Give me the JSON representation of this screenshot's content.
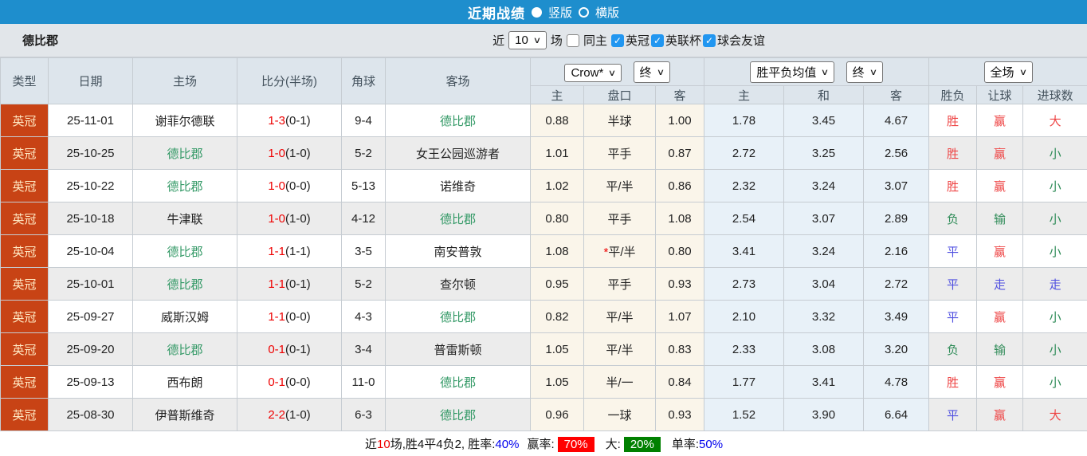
{
  "top_bar": {
    "title": "近期战绩",
    "radio_vertical": "竖版",
    "radio_horizontal": "横版"
  },
  "filter_bar": {
    "team": "德比郡",
    "near_label": "近",
    "matches_value": "10",
    "matches_label": "场",
    "same_home_label": "同主",
    "checkboxes": [
      {
        "label": "英冠",
        "checked": true
      },
      {
        "label": "英联杯",
        "checked": true
      },
      {
        "label": "球会友谊",
        "checked": true
      }
    ]
  },
  "table": {
    "left_headers": [
      "类型",
      "日期",
      "主场",
      "比分(半场)",
      "角球",
      "客场"
    ],
    "selects": {
      "odds_company": "Crow*",
      "odds_stage_1": "终",
      "avg_type": "胜平负均值",
      "odds_stage_2": "终",
      "scope": "全场"
    },
    "sub_headers": [
      "主",
      "盘口",
      "客",
      "主",
      "和",
      "客",
      "胜负",
      "让球",
      "进球数"
    ],
    "rows": [
      {
        "league": "英冠",
        "date": "25-11-01",
        "home": "谢菲尔德联",
        "home_self": false,
        "score": "1-3",
        "half_score": "(0-1)",
        "corners": "9-4",
        "away": "德比郡",
        "away_self": true,
        "ah_home": "0.88",
        "handicap_star": "",
        "handicap": "半球",
        "ah_away": "1.00",
        "avg_home": "1.78",
        "avg_draw": "3.45",
        "avg_away": "4.67",
        "result": "胜",
        "result_c": "red",
        "give": "赢",
        "give_c": "red",
        "goals": "大",
        "goals_c": "red"
      },
      {
        "league": "英冠",
        "date": "25-10-25",
        "home": "德比郡",
        "home_self": true,
        "score": "1-0",
        "half_score": "(1-0)",
        "corners": "5-2",
        "away": "女王公园巡游者",
        "away_self": false,
        "ah_home": "1.01",
        "handicap_star": "",
        "handicap": "平手",
        "ah_away": "0.87",
        "avg_home": "2.72",
        "avg_draw": "3.25",
        "avg_away": "2.56",
        "result": "胜",
        "result_c": "red",
        "give": "赢",
        "give_c": "red",
        "goals": "小",
        "goals_c": "green"
      },
      {
        "league": "英冠",
        "date": "25-10-22",
        "home": "德比郡",
        "home_self": true,
        "score": "1-0",
        "half_score": "(0-0)",
        "corners": "5-13",
        "away": "诺维奇",
        "away_self": false,
        "ah_home": "1.02",
        "handicap_star": "",
        "handicap": "平/半",
        "ah_away": "0.86",
        "avg_home": "2.32",
        "avg_draw": "3.24",
        "avg_away": "3.07",
        "result": "胜",
        "result_c": "red",
        "give": "赢",
        "give_c": "red",
        "goals": "小",
        "goals_c": "green"
      },
      {
        "league": "英冠",
        "date": "25-10-18",
        "home": "牛津联",
        "home_self": false,
        "score": "1-0",
        "half_score": "(1-0)",
        "corners": "4-12",
        "away": "德比郡",
        "away_self": true,
        "ah_home": "0.80",
        "handicap_star": "",
        "handicap": "平手",
        "ah_away": "1.08",
        "avg_home": "2.54",
        "avg_draw": "3.07",
        "avg_away": "2.89",
        "result": "负",
        "result_c": "green",
        "give": "输",
        "give_c": "green",
        "goals": "小",
        "goals_c": "green"
      },
      {
        "league": "英冠",
        "date": "25-10-04",
        "home": "德比郡",
        "home_self": true,
        "score": "1-1",
        "half_score": "(1-1)",
        "corners": "3-5",
        "away": "南安普敦",
        "away_self": false,
        "ah_home": "1.08",
        "handicap_star": "*",
        "handicap": "平/半",
        "ah_away": "0.80",
        "avg_home": "3.41",
        "avg_draw": "3.24",
        "avg_away": "2.16",
        "result": "平",
        "result_c": "blue",
        "give": "赢",
        "give_c": "red",
        "goals": "小",
        "goals_c": "green"
      },
      {
        "league": "英冠",
        "date": "25-10-01",
        "home": "德比郡",
        "home_self": true,
        "score": "1-1",
        "half_score": "(0-1)",
        "corners": "5-2",
        "away": "查尔顿",
        "away_self": false,
        "ah_home": "0.95",
        "handicap_star": "",
        "handicap": "平手",
        "ah_away": "0.93",
        "avg_home": "2.73",
        "avg_draw": "3.04",
        "avg_away": "2.72",
        "result": "平",
        "result_c": "blue",
        "give": "走",
        "give_c": "blue",
        "goals": "走",
        "goals_c": "blue"
      },
      {
        "league": "英冠",
        "date": "25-09-27",
        "home": "威斯汉姆",
        "home_self": false,
        "score": "1-1",
        "half_score": "(0-0)",
        "corners": "4-3",
        "away": "德比郡",
        "away_self": true,
        "ah_home": "0.82",
        "handicap_star": "",
        "handicap": "平/半",
        "ah_away": "1.07",
        "avg_home": "2.10",
        "avg_draw": "3.32",
        "avg_away": "3.49",
        "result": "平",
        "result_c": "blue",
        "give": "赢",
        "give_c": "red",
        "goals": "小",
        "goals_c": "green"
      },
      {
        "league": "英冠",
        "date": "25-09-20",
        "home": "德比郡",
        "home_self": true,
        "score": "0-1",
        "half_score": "(0-1)",
        "corners": "3-4",
        "away": "普雷斯顿",
        "away_self": false,
        "ah_home": "1.05",
        "handicap_star": "",
        "handicap": "平/半",
        "ah_away": "0.83",
        "avg_home": "2.33",
        "avg_draw": "3.08",
        "avg_away": "3.20",
        "result": "负",
        "result_c": "green",
        "give": "输",
        "give_c": "green",
        "goals": "小",
        "goals_c": "green"
      },
      {
        "league": "英冠",
        "date": "25-09-13",
        "home": "西布朗",
        "home_self": false,
        "score": "0-1",
        "half_score": "(0-0)",
        "corners": "11-0",
        "away": "德比郡",
        "away_self": true,
        "ah_home": "1.05",
        "handicap_star": "",
        "handicap": "半/一",
        "ah_away": "0.84",
        "avg_home": "1.77",
        "avg_draw": "3.41",
        "avg_away": "4.78",
        "result": "胜",
        "result_c": "red",
        "give": "赢",
        "give_c": "red",
        "goals": "小",
        "goals_c": "green"
      },
      {
        "league": "英冠",
        "date": "25-08-30",
        "home": "伊普斯维奇",
        "home_self": false,
        "score": "2-2",
        "half_score": "(1-0)",
        "corners": "6-3",
        "away": "德比郡",
        "away_self": true,
        "ah_home": "0.96",
        "handicap_star": "",
        "handicap": "一球",
        "ah_away": "0.93",
        "avg_home": "1.52",
        "avg_draw": "3.90",
        "avg_away": "6.64",
        "result": "平",
        "result_c": "blue",
        "give": "赢",
        "give_c": "red",
        "goals": "大",
        "goals_c": "red"
      }
    ]
  },
  "summary": {
    "prefix": "近",
    "count": "10",
    "record": "场,胜4平4负2, 胜率:",
    "win_rate": "40%",
    "label_win": "赢率:",
    "win_pct": "70%",
    "label_big": "大:",
    "big_pct": "20%",
    "label_single": "单率:",
    "single_rate": "50%"
  },
  "colors": {
    "accent_blue": "#1e8ecd",
    "league_badge_red": "#c84315",
    "self_team_green": "#339966",
    "win_red": "#ee4444",
    "lose_green": "#2e8b57",
    "draw_blue": "#5050e0",
    "score_red": "#ee0000",
    "rate_blue": "#0000ee",
    "pct_block_red": "#ff0000",
    "pct_block_green": "#008000"
  }
}
